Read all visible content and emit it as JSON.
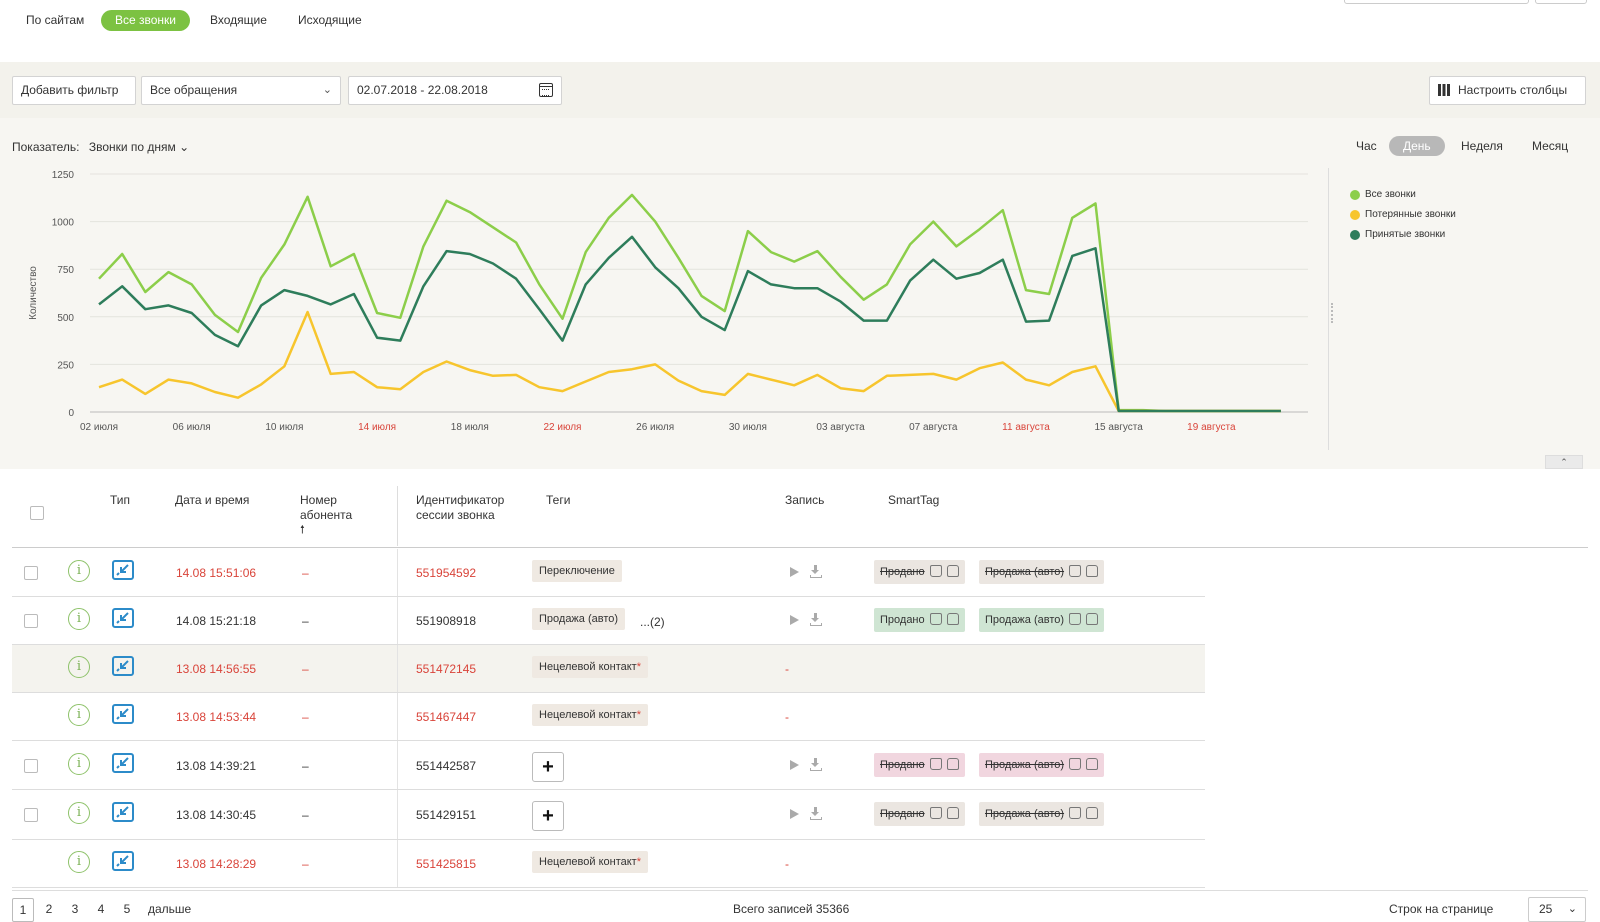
{
  "top_tabs": [
    "По сайтам",
    "Все звонки",
    "Входящие",
    "Исходящие"
  ],
  "filters": {
    "add_filter": "Добавить фильтр",
    "requests_select": "Все обращения",
    "date_range": "02.07.2018 - 22.08.2018",
    "columns_button": "Настроить столбцы"
  },
  "chart_header": {
    "indicator_label": "Показатель:",
    "indicator_value": "Звонки по дням",
    "periods": [
      "Час",
      "День",
      "Неделя",
      "Месяц"
    ],
    "active_period": "День"
  },
  "colors": {
    "accent_green": "#7cc242",
    "all_calls": "#8cce4a",
    "lost_calls": "#f7c52d",
    "accepted_calls": "#2e7d5b",
    "red_text": "#d9443a"
  },
  "chart_data": {
    "type": "line",
    "ylabel": "Количество",
    "ylim": [
      0,
      1250
    ],
    "yticks": [
      0,
      250,
      500,
      750,
      1000,
      1250
    ],
    "xtick_labels": [
      "02 июля",
      "06 июля",
      "10 июля",
      "14 июля",
      "18 июля",
      "22 июля",
      "26 июля",
      "30 июля",
      "03 августа",
      "07 августа",
      "11 августа",
      "15 августа",
      "19 августа"
    ],
    "weekend_ticks": [
      "14 июля",
      "22 июля",
      "11 августа",
      "19 августа"
    ],
    "x_days": 52,
    "legend_placement": "right",
    "series": [
      {
        "name": "Все звонки",
        "color": "#8cce4a",
        "values": [
          700,
          830,
          630,
          735,
          670,
          510,
          420,
          705,
          880,
          1130,
          765,
          830,
          520,
          495,
          870,
          1110,
          1050,
          970,
          890,
          670,
          490,
          840,
          1020,
          1140,
          1000,
          810,
          610,
          530,
          950,
          840,
          790,
          845,
          710,
          590,
          670,
          880,
          1000,
          870,
          960,
          1060,
          640,
          620,
          1020,
          1095,
          10,
          10,
          5,
          5,
          5,
          5,
          5,
          5
        ]
      },
      {
        "name": "Потерянные звонки",
        "color": "#f7c52d",
        "values": [
          130,
          170,
          95,
          170,
          150,
          105,
          75,
          145,
          240,
          525,
          200,
          210,
          130,
          120,
          210,
          265,
          220,
          190,
          195,
          130,
          110,
          160,
          210,
          225,
          250,
          165,
          110,
          90,
          200,
          170,
          140,
          195,
          125,
          110,
          190,
          195,
          200,
          170,
          230,
          260,
          170,
          140,
          210,
          240,
          5,
          5,
          5,
          5,
          5,
          5,
          5,
          5
        ]
      },
      {
        "name": "Принятые звонки",
        "color": "#2e7d5b",
        "values": [
          565,
          660,
          540,
          560,
          520,
          405,
          345,
          560,
          640,
          610,
          565,
          620,
          390,
          375,
          660,
          845,
          830,
          780,
          700,
          540,
          375,
          670,
          810,
          920,
          760,
          650,
          500,
          430,
          740,
          670,
          650,
          650,
          580,
          480,
          480,
          690,
          800,
          700,
          730,
          800,
          475,
          480,
          820,
          860,
          5,
          5,
          5,
          5,
          5,
          5,
          5,
          5
        ]
      }
    ]
  },
  "table": {
    "headers": {
      "type": "Тип",
      "datetime": "Дата и время",
      "subscriber_line1": "Номер",
      "subscriber_line2": "абонента",
      "sort_arrow": "🠕",
      "session_line1": "Идентификатор",
      "session_line2": "сессии звонка",
      "tags": "Теги",
      "record": "Запись",
      "smarttag": "SmartTag"
    },
    "rows": [
      {
        "checkbox": true,
        "datetime": "14.08 15:51:06",
        "red": true,
        "subscriber": "–",
        "session": "551954592",
        "tag": "Переключение",
        "tag_star": "",
        "more": "",
        "plus": false,
        "record": true,
        "smart": [
          {
            "label": "Продано",
            "style": "neutral",
            "strike": true
          },
          {
            "label": "Продажа (авто)",
            "style": "neutral",
            "strike": true
          }
        ]
      },
      {
        "checkbox": true,
        "datetime": "14.08 15:21:18",
        "red": false,
        "subscriber": "–",
        "session": "551908918",
        "tag": "Продажа (авто)",
        "tag_star": "",
        "more": "...(2)",
        "plus": false,
        "record": true,
        "smart": [
          {
            "label": "Продано",
            "style": "green",
            "strike": false
          },
          {
            "label": "Продажа (авто)",
            "style": "green",
            "strike": false
          }
        ]
      },
      {
        "checkbox": false,
        "datetime": "13.08 14:56:55",
        "red": true,
        "subscriber": "–",
        "session": "551472145",
        "tag": "Нецелевой контакт",
        "tag_star": "*",
        "more": "",
        "plus": false,
        "record": false,
        "record_text": "-",
        "smart": []
      },
      {
        "checkbox": false,
        "datetime": "13.08 14:53:44",
        "red": true,
        "subscriber": "–",
        "session": "551467447",
        "tag": "Нецелевой контакт",
        "tag_star": "*",
        "more": "",
        "plus": false,
        "record": false,
        "record_text": "-",
        "smart": []
      },
      {
        "checkbox": true,
        "datetime": "13.08 14:39:21",
        "red": false,
        "subscriber": "–",
        "session": "551442587",
        "tag": "",
        "tag_star": "",
        "more": "",
        "plus": true,
        "record": true,
        "smart": [
          {
            "label": "Продано",
            "style": "pink",
            "strike": true
          },
          {
            "label": "Продажа (авто)",
            "style": "pink",
            "strike": true
          }
        ]
      },
      {
        "checkbox": true,
        "datetime": "13.08 14:30:45",
        "red": false,
        "subscriber": "–",
        "session": "551429151",
        "tag": "",
        "tag_star": "",
        "more": "",
        "plus": true,
        "record": true,
        "smart": [
          {
            "label": "Продано",
            "style": "neutral",
            "strike": true
          },
          {
            "label": "Продажа (авто)",
            "style": "neutral",
            "strike": true
          }
        ]
      },
      {
        "checkbox": false,
        "datetime": "13.08 14:28:29",
        "red": true,
        "subscriber": "–",
        "session": "551425815",
        "tag": "Нецелевой контакт",
        "tag_star": "*",
        "more": "",
        "plus": false,
        "record": false,
        "record_text": "-",
        "smart": []
      }
    ]
  },
  "footer": {
    "pages": [
      "1",
      "2",
      "3",
      "4",
      "5"
    ],
    "next": "дальше",
    "total": "Всего записей 35366",
    "rows_label": "Строк на странице",
    "rows_value": "25"
  }
}
